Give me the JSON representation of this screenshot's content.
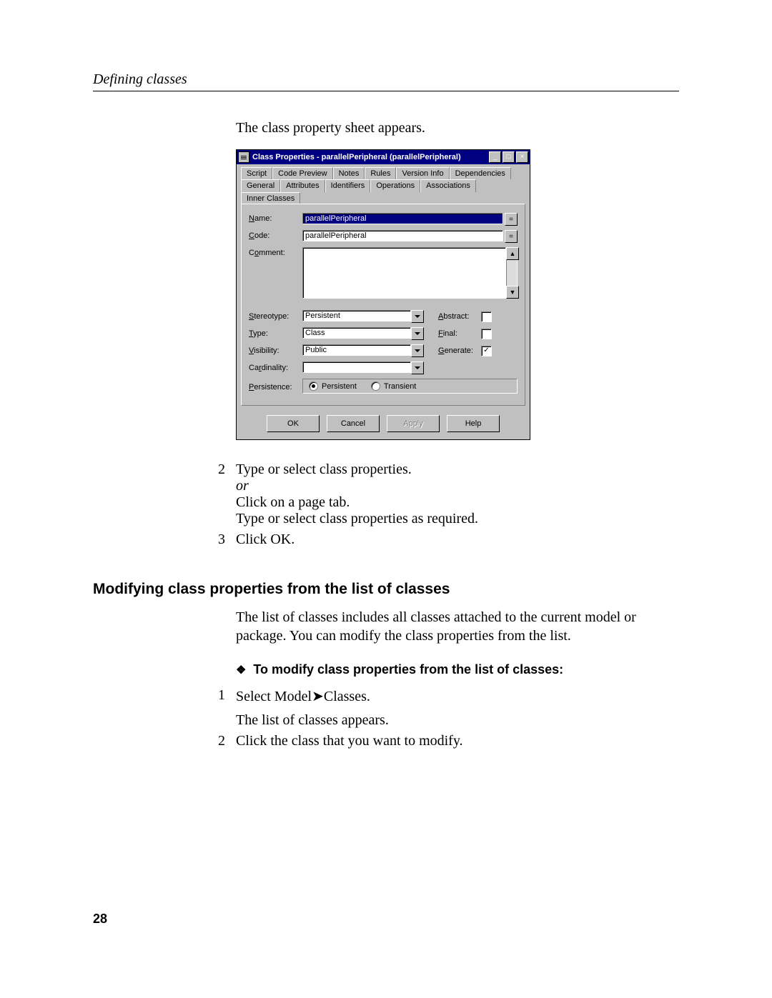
{
  "header": "Defining classes",
  "intro": "The class property sheet appears.",
  "dialog": {
    "title": "Class Properties - parallelPeripheral (parallelPeripheral)",
    "tabs_row1": [
      "Script",
      "Code Preview",
      "Notes",
      "Rules",
      "Version Info",
      "Dependencies"
    ],
    "tabs_row2": [
      "General",
      "Attributes",
      "Identifiers",
      "Operations",
      "Associations",
      "Inner Classes"
    ],
    "active_tab": "General",
    "labels": {
      "name": "Name:",
      "code": "Code:",
      "comment": "Comment:",
      "stereotype": "Stereotype:",
      "type": "Type:",
      "visibility": "Visibility:",
      "cardinality": "Cardinality:",
      "persistence": "Persistence:",
      "abstract": "Abstract:",
      "final": "Final:",
      "generate": "Generate:"
    },
    "values": {
      "name": "parallelPeripheral",
      "code": "parallelPeripheral",
      "comment": "",
      "stereotype": "Persistent",
      "type": "Class",
      "visibility": "Public",
      "cardinality": "",
      "abstract_checked": false,
      "final_checked": false,
      "generate_checked": true,
      "persistence": "Persistent"
    },
    "radios": {
      "persistent": "Persistent",
      "transient": "Transient"
    },
    "buttons": {
      "ok": "OK",
      "cancel": "Cancel",
      "apply": "Apply",
      "help": "Help"
    }
  },
  "steps1": {
    "s2a": "Type or select class properties.",
    "s2or": "or",
    "s2b": "Click on a page tab.",
    "s2c": "Type or select class properties as required.",
    "s3": "Click OK."
  },
  "section2": {
    "heading": "Modifying class properties from the list of classes",
    "para": "The list of classes includes all classes attached to the current model or package. You can modify the class properties from the list.",
    "task_heading": "To modify class properties from the list of classes:",
    "s1a": "Select Model",
    "s1b": "Classes.",
    "s1c": "The list of classes appears.",
    "s2": "Click the class that you want to modify."
  },
  "page_number": "28"
}
